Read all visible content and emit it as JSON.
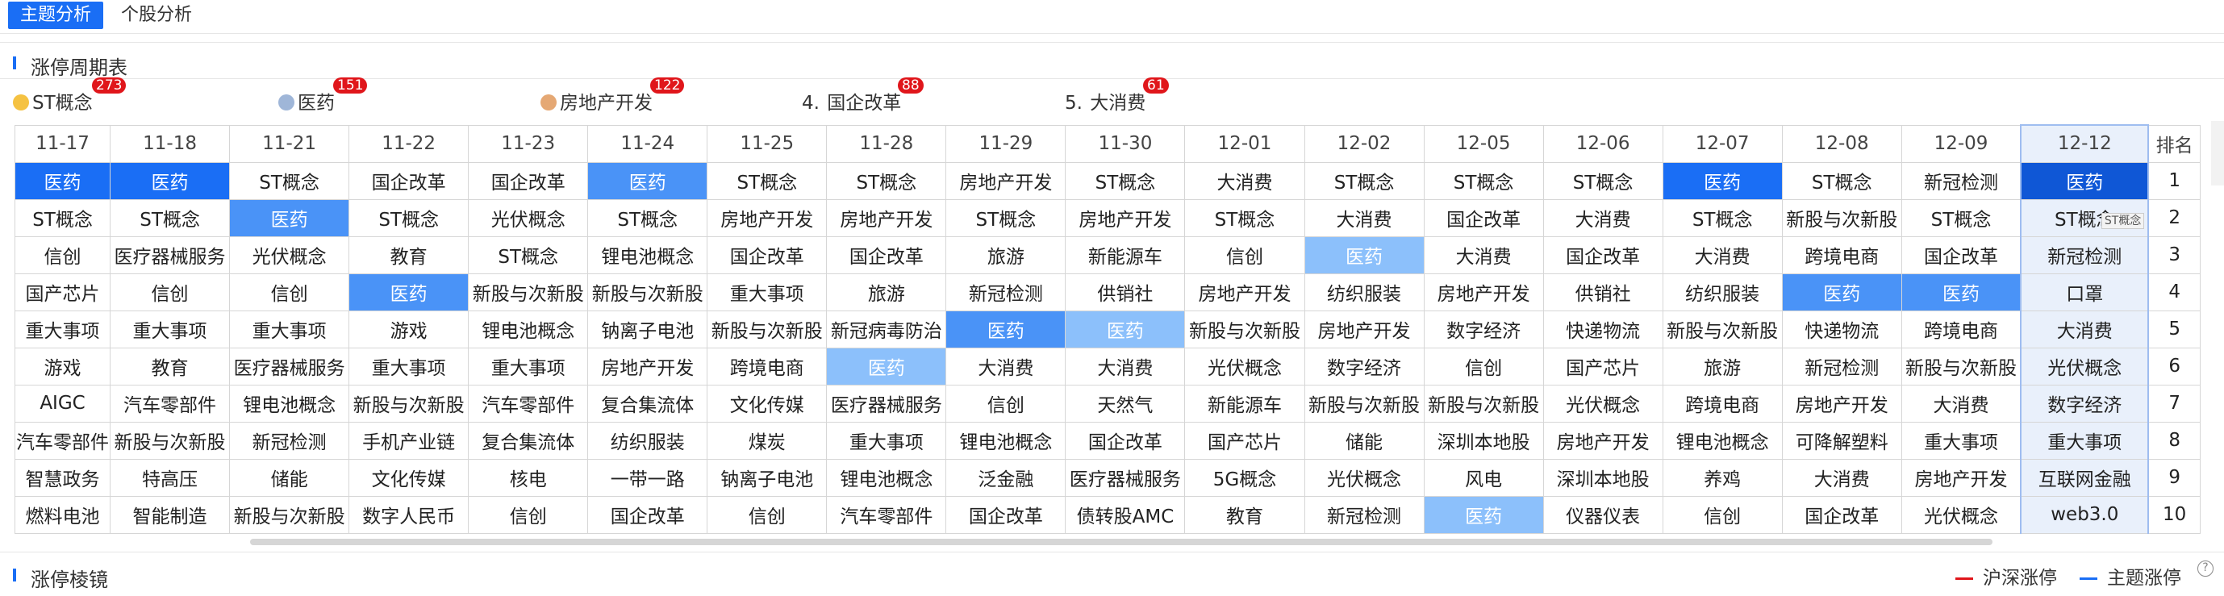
{
  "tabs": [
    {
      "label": "主题分析",
      "active": true
    },
    {
      "label": "个股分析",
      "active": false
    }
  ],
  "section1_title": "涨停周期表",
  "legend": [
    {
      "rank": "",
      "name": "ST概念",
      "count": "273",
      "medal": "gold-medal-icon",
      "color": "#f5c242"
    },
    {
      "rank": "",
      "name": "医药",
      "count": "151",
      "medal": "silver-medal-icon",
      "color": "#9fb6d8"
    },
    {
      "rank": "",
      "name": "房地产开发",
      "count": "122",
      "medal": "bronze-medal-icon",
      "color": "#e5a874"
    },
    {
      "rank": "4.",
      "name": "国企改革",
      "count": "88",
      "medal": "",
      "color": ""
    },
    {
      "rank": "5.",
      "name": "大消费",
      "count": "61",
      "medal": "",
      "color": ""
    }
  ],
  "grid": {
    "dates": [
      "11-17",
      "11-18",
      "11-21",
      "11-22",
      "11-23",
      "11-24",
      "11-25",
      "11-28",
      "11-29",
      "11-30",
      "12-01",
      "12-02",
      "12-05",
      "12-06",
      "12-07",
      "12-08",
      "12-09",
      "12-12"
    ],
    "rank_header": "排名",
    "ranks": [
      "1",
      "2",
      "3",
      "4",
      "5",
      "6",
      "7",
      "8",
      "9",
      "10"
    ],
    "rows": [
      [
        "医药",
        "医药",
        "ST概念",
        "国企改革",
        "国企改革",
        "医药",
        "ST概念",
        "ST概念",
        "房地产开发",
        "ST概念",
        "大消费",
        "ST概念",
        "ST概念",
        "ST概念",
        "医药",
        "ST概念",
        "新冠检测",
        "医药"
      ],
      [
        "ST概念",
        "ST概念",
        "医药",
        "ST概念",
        "光伏概念",
        "ST概念",
        "房地产开发",
        "房地产开发",
        "ST概念",
        "房地产开发",
        "ST概念",
        "大消费",
        "国企改革",
        "大消费",
        "ST概念",
        "新股与次新股",
        "ST概念",
        "ST概念"
      ],
      [
        "信创",
        "医疗器械服务",
        "光伏概念",
        "教育",
        "ST概念",
        "锂电池概念",
        "国企改革",
        "国企改革",
        "旅游",
        "新能源车",
        "信创",
        "医药",
        "大消费",
        "国企改革",
        "大消费",
        "跨境电商",
        "国企改革",
        "新冠检测"
      ],
      [
        "国产芯片",
        "信创",
        "信创",
        "医药",
        "新股与次新股",
        "新股与次新股",
        "重大事项",
        "旅游",
        "新冠检测",
        "供销社",
        "房地产开发",
        "纺织服装",
        "房地产开发",
        "供销社",
        "纺织服装",
        "医药",
        "医药",
        "口罩"
      ],
      [
        "重大事项",
        "重大事项",
        "重大事项",
        "游戏",
        "锂电池概念",
        "钠离子电池",
        "新股与次新股",
        "新冠病毒防治",
        "医药",
        "医药",
        "新股与次新股",
        "房地产开发",
        "数字经济",
        "快递物流",
        "新股与次新股",
        "快递物流",
        "跨境电商",
        "大消费"
      ],
      [
        "游戏",
        "教育",
        "医疗器械服务",
        "重大事项",
        "重大事项",
        "房地产开发",
        "跨境电商",
        "医药",
        "大消费",
        "大消费",
        "光伏概念",
        "数字经济",
        "信创",
        "国产芯片",
        "旅游",
        "新冠检测",
        "新股与次新股",
        "光伏概念"
      ],
      [
        "AIGC",
        "汽车零部件",
        "锂电池概念",
        "新股与次新股",
        "汽车零部件",
        "复合集流体",
        "文化传媒",
        "医疗器械服务",
        "信创",
        "天然气",
        "新能源车",
        "新股与次新股",
        "新股与次新股",
        "光伏概念",
        "跨境电商",
        "房地产开发",
        "大消费",
        "数字经济"
      ],
      [
        "汽车零部件",
        "新股与次新股",
        "新冠检测",
        "手机产业链",
        "复合集流体",
        "纺织服装",
        "煤炭",
        "重大事项",
        "锂电池概念",
        "国企改革",
        "国产芯片",
        "储能",
        "深圳本地股",
        "房地产开发",
        "锂电池概念",
        "可降解塑料",
        "重大事项",
        "重大事项"
      ],
      [
        "智慧政务",
        "特高压",
        "储能",
        "文化传媒",
        "核电",
        "一带一路",
        "钠离子电池",
        "锂电池概念",
        "泛金融",
        "医疗器械服务",
        "5G概念",
        "光伏概念",
        "风电",
        "深圳本地股",
        "养鸡",
        "大消费",
        "房地产开发",
        "互联网金融"
      ],
      [
        "燃料电池",
        "智能制造",
        "新股与次新股",
        "数字人民币",
        "信创",
        "国企改革",
        "信创",
        "汽车零部件",
        "国企改革",
        "债转股AMC",
        "教育",
        "新冠检测",
        "医药",
        "仪器仪表",
        "信创",
        "国企改革",
        "光伏概念",
        "web3.0"
      ]
    ]
  },
  "tooltip_mini": "ST概念",
  "section2_title": "涨停棱镜",
  "line_legend": [
    {
      "label": "沪深涨停",
      "color": "#e0161b"
    },
    {
      "label": "主题涨停",
      "color": "#1a6ef5"
    }
  ],
  "help_glyph": "?"
}
